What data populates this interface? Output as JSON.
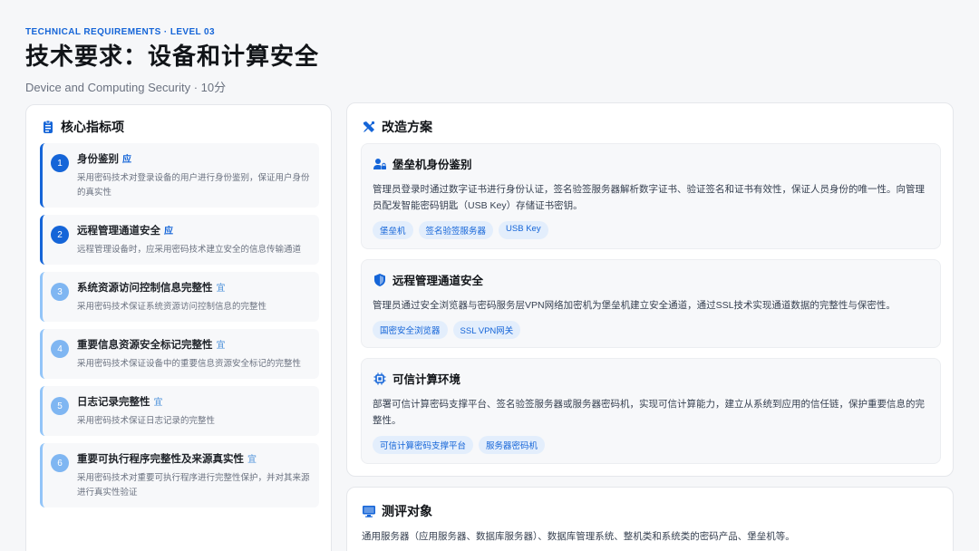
{
  "header": {
    "kicker": "TECHNICAL REQUIREMENTS · LEVEL 03",
    "title": "技术要求：设备和计算安全",
    "subtitle": "Device and Computing Security · 10分"
  },
  "indicators": {
    "heading": "核心指标项",
    "items": [
      {
        "num": "1",
        "title": "身份鉴别",
        "tag": "应",
        "desc": "采用密码技术对登录设备的用户进行身份鉴别，保证用户身份的真实性"
      },
      {
        "num": "2",
        "title": "远程管理通道安全",
        "tag": "应",
        "desc": "远程管理设备时，应采用密码技术建立安全的信息传输通道"
      },
      {
        "num": "3",
        "title": "系统资源访问控制信息完整性",
        "tag": "宜",
        "desc": "采用密码技术保证系统资源访问控制信息的完整性"
      },
      {
        "num": "4",
        "title": "重要信息资源安全标记完整性",
        "tag": "宜",
        "desc": "采用密码技术保证设备中的重要信息资源安全标记的完整性"
      },
      {
        "num": "5",
        "title": "日志记录完整性",
        "tag": "宜",
        "desc": "采用密码技术保证日志记录的完整性"
      },
      {
        "num": "6",
        "title": "重要可执行程序完整性及来源真实性",
        "tag": "宜",
        "desc": "采用密码技术对重要可执行程序进行完整性保护，并对其来源进行真实性验证"
      }
    ]
  },
  "plans": {
    "heading": "改造方案",
    "cards": [
      {
        "title": "堡垒机身份鉴别",
        "text": "管理员登录时通过数字证书进行身份认证，签名验签服务器解析数字证书、验证签名和证书有效性，保证人员身份的唯一性。向管理员配发智能密码钥匙（USB Key）存储证书密钥。",
        "chips": [
          "堡垒机",
          "签名验签服务器",
          "USB Key"
        ]
      },
      {
        "title": "远程管理通道安全",
        "text": "管理员通过安全浏览器与密码服务层VPN网络加密机为堡垒机建立安全通道，通过SSL技术实现通道数据的完整性与保密性。",
        "chips": [
          "国密安全浏览器",
          "SSL VPN网关"
        ]
      },
      {
        "title": "可信计算环境",
        "text": "部署可信计算密码支撑平台、签名验签服务器或服务器密码机，实现可信计算能力，建立从系统到应用的信任链，保护重要信息的完整性。",
        "chips": [
          "可信计算密码支撑平台",
          "服务器密码机"
        ]
      }
    ]
  },
  "target": {
    "heading": "测评对象",
    "text": "通用服务器（应用服务器、数据库服务器）、数据库管理系统、整机类和系统类的密码产品、堡垒机等。"
  },
  "icons": {
    "indicators": "clipboard-list-icon",
    "plans": "tools-icon",
    "card1": "user-lock-icon",
    "card2": "shield-icon",
    "card3": "chip-icon",
    "target": "monitor-icon"
  },
  "colors": {
    "accent": "#1565d8",
    "accent_light": "#7fb6f2",
    "chip_bg": "#e3eefc"
  }
}
